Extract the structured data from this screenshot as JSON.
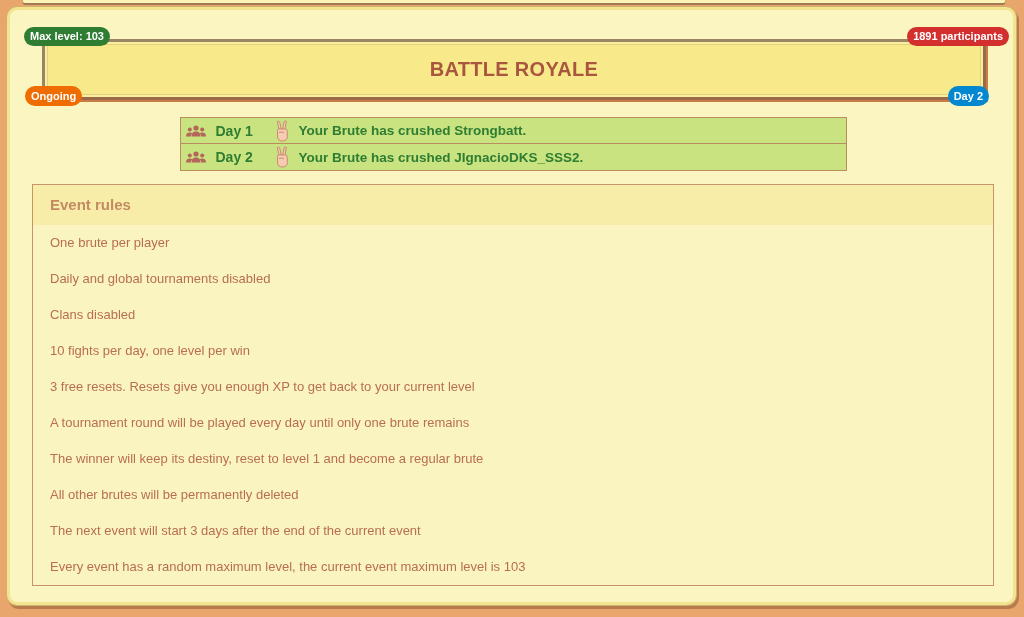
{
  "header": {
    "title": "BATTLE ROYALE",
    "max_level": "Max level: 103",
    "participants": "1891 participants",
    "status": "Ongoing",
    "day": "Day 2"
  },
  "fights": [
    {
      "day": "Day 1",
      "text": "Your Brute has crushed Strongbatt."
    },
    {
      "day": "Day 2",
      "text": "Your Brute has crushed JIgnacioDKS_SSS2."
    }
  ],
  "rules": {
    "title": "Event rules",
    "items": [
      "One brute per player",
      "Daily and global tournaments disabled",
      "Clans disabled",
      "10 fights per day, one level per win",
      "3 free resets. Resets give you enough XP to get back to your current level",
      "A tournament round will be played every day until only one brute remains",
      "The winner will keep its destiny, reset to level 1 and become a regular brute",
      "All other brutes will be permanently deleted",
      "The next event will start 3 days after the end of the current event",
      "Every event has a random maximum level, the current event maximum level is 103"
    ]
  }
}
